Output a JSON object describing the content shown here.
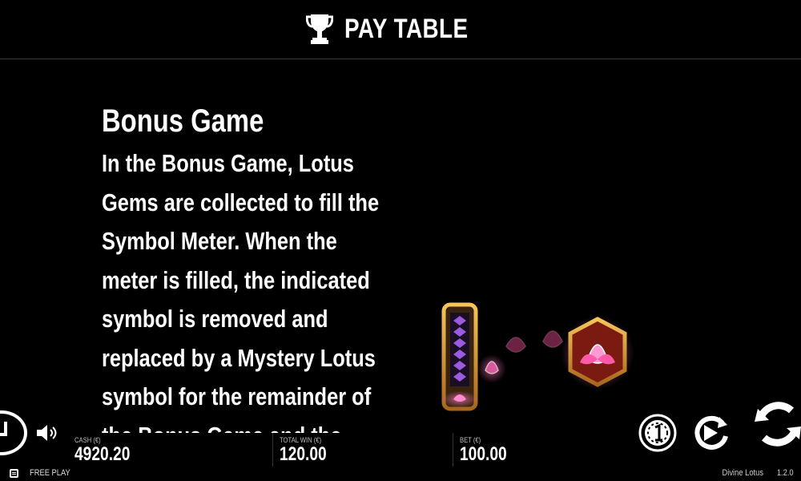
{
  "header": {
    "title": "PAY TABLE",
    "icon": "trophy-icon"
  },
  "content": {
    "heading": "Bonus Game",
    "lines": [
      "In the Bonus Game, Lotus",
      "Gems are collected to fill the",
      "Symbol Meter. When the",
      "meter is filled, the indicated",
      "symbol is removed and",
      "replaced by a Mystery Lotus",
      "symbol for the remainder of",
      "the Bonus Game and the"
    ]
  },
  "stats": {
    "cash": {
      "label": "CASH (€)",
      "value": "4920.20"
    },
    "total_win": {
      "label": "TOTAL WIN (€)",
      "value": "120.00"
    },
    "bet": {
      "label": "BET (€)",
      "value": "100.00"
    }
  },
  "footer": {
    "mode": "FREE PLAY",
    "game_name": "Divine Lotus",
    "version": "1.2.0"
  },
  "colors": {
    "background": "#000000",
    "text": "#ffffff",
    "gold": "#e8a63a",
    "lotus_pink": "#ff5aa8",
    "meter_purple": "#8a4dd6"
  }
}
